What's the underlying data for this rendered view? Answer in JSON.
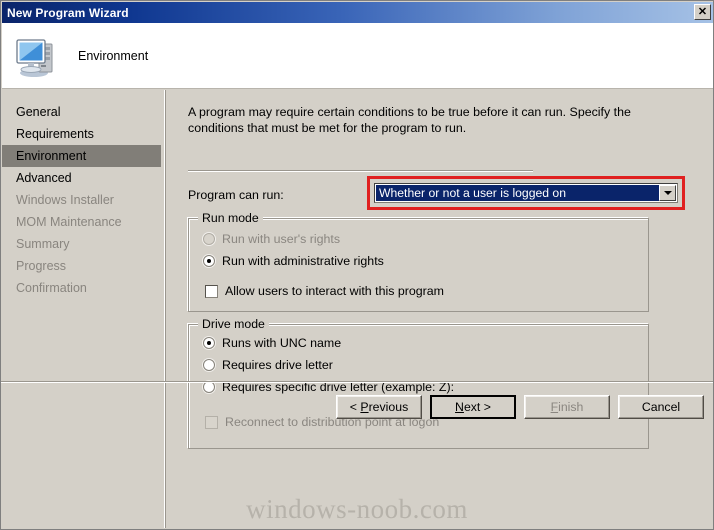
{
  "window": {
    "title": "New Program Wizard",
    "close_label": "✕"
  },
  "header": {
    "icon": "computer-icon",
    "title": "Environment"
  },
  "sidebar": {
    "items": [
      {
        "label": "General",
        "state": "enabled"
      },
      {
        "label": "Requirements",
        "state": "enabled"
      },
      {
        "label": "Environment",
        "state": "selected"
      },
      {
        "label": "Advanced",
        "state": "enabled"
      },
      {
        "label": "Windows Installer",
        "state": "disabled"
      },
      {
        "label": "MOM Maintenance",
        "state": "disabled"
      },
      {
        "label": "Summary",
        "state": "disabled"
      },
      {
        "label": "Progress",
        "state": "disabled"
      },
      {
        "label": "Confirmation",
        "state": "disabled"
      }
    ]
  },
  "main": {
    "intro": "A program may require certain conditions to be true before it can run. Specify the conditions that must be met for the program to run.",
    "program_can_run": {
      "label": "Program can run:",
      "selected_value": "Whether or not a user is logged on",
      "highlight_color": "#e02020"
    },
    "run_mode": {
      "title": "Run mode",
      "options": [
        {
          "label": "Run with user's rights",
          "checked": false,
          "disabled": true
        },
        {
          "label": "Run with administrative rights",
          "checked": true,
          "disabled": false
        }
      ],
      "checkbox": {
        "label": "Allow users to interact with this program",
        "checked": false,
        "disabled": false
      }
    },
    "drive_mode": {
      "title": "Drive mode",
      "options": [
        {
          "label": "Runs with UNC name",
          "checked": true,
          "disabled": false
        },
        {
          "label": "Requires drive letter",
          "checked": false,
          "disabled": false
        },
        {
          "label": "Requires specific drive letter (example: Z):",
          "checked": false,
          "disabled": false
        }
      ],
      "checkbox": {
        "label": "Reconnect to distribution point at logon",
        "checked": false,
        "disabled": true
      }
    }
  },
  "footer": {
    "buttons": [
      {
        "label": "< Previous",
        "accel": "P",
        "disabled": false,
        "default": false
      },
      {
        "label": "Next >",
        "accel": "N",
        "disabled": false,
        "default": true
      },
      {
        "label": "Finish",
        "accel": "F",
        "disabled": true,
        "default": false
      },
      {
        "label": "Cancel",
        "accel": "",
        "disabled": false,
        "default": false
      }
    ]
  },
  "watermark": {
    "text": "windows-noob.com"
  }
}
